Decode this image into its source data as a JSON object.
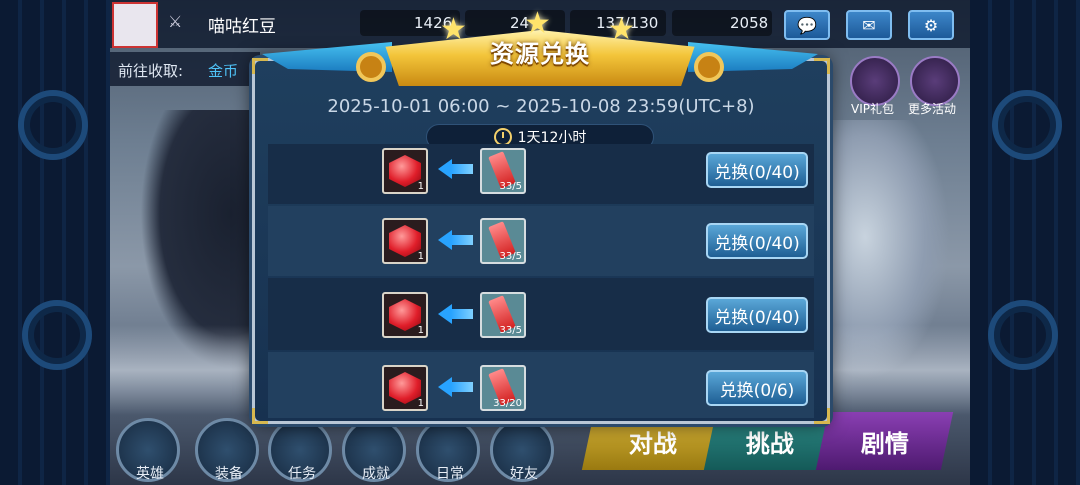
{
  "player": {
    "name": "喵咕红豆"
  },
  "resources": {
    "gold": "1426",
    "gems": "24",
    "stamina": "137/130",
    "diamonds": "2058"
  },
  "goto": {
    "label": "前往收取:",
    "link": "金币"
  },
  "side_menu": [
    {
      "label": "VIP礼包"
    },
    {
      "label": "更多活动"
    }
  ],
  "modal": {
    "title": "资源兑换",
    "date_range": "2025-10-01 06:00 ~ 2025-10-08 23:59(UTC+8)",
    "timer": "1天12小时",
    "rows": [
      {
        "src_qty": "1",
        "cost_qty": "33/5",
        "button": "兑换(0/40)"
      },
      {
        "src_qty": "1",
        "cost_qty": "33/5",
        "button": "兑换(0/40)"
      },
      {
        "src_qty": "1",
        "cost_qty": "33/5",
        "button": "兑换(0/40)"
      },
      {
        "src_qty": "1",
        "cost_qty": "33/20",
        "button": "兑换(0/6)"
      }
    ]
  },
  "bottom_nav": [
    {
      "label": "英雄"
    },
    {
      "label": "装备"
    },
    {
      "label": "任务"
    },
    {
      "label": "成就"
    },
    {
      "label": "日常"
    },
    {
      "label": "好友"
    }
  ],
  "actions": {
    "fight": "对战",
    "challenge": "挑战",
    "story": "剧情"
  },
  "colors": {
    "accent_blue": "#28a3ff",
    "gold": "#f3c53a",
    "modal_bg": "#1f3f5e"
  }
}
